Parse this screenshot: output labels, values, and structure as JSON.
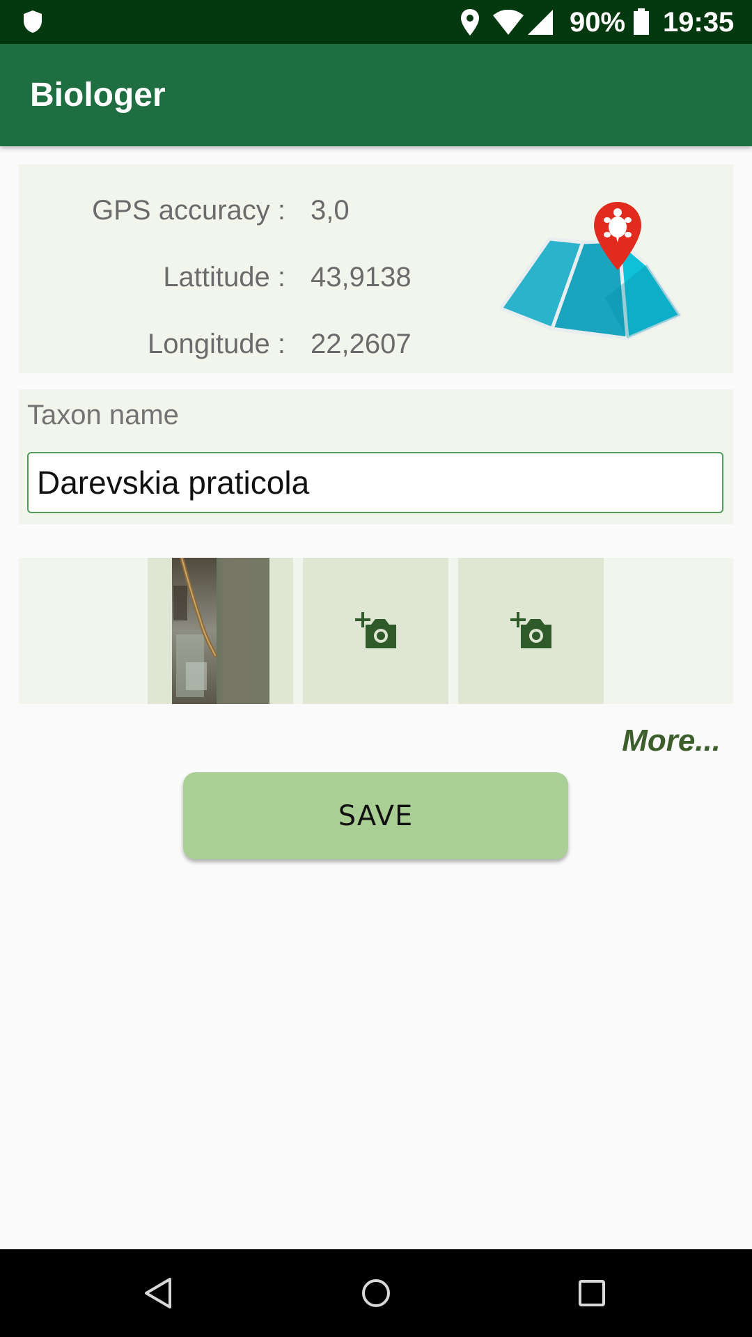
{
  "status_bar": {
    "battery_text": "90%",
    "time": "19:35",
    "icons": [
      "shield-icon",
      "location-icon",
      "wifi-icon",
      "cell-signal-icon",
      "battery-icon"
    ]
  },
  "app_bar": {
    "title": "Biologer"
  },
  "gps": {
    "accuracy_label": "GPS accuracy :",
    "accuracy_value": "3,0",
    "latitude_label": "Lattitude :",
    "latitude_value": "43,9138",
    "longitude_label": "Longitude :",
    "longitude_value": "22,2607",
    "map_icon": "map-pin-turtle-icon"
  },
  "taxon": {
    "label": "Taxon name",
    "value": "Darevskia praticola"
  },
  "photos": {
    "slots": [
      {
        "type": "photo",
        "description": "lizard-on-tree-thumbnail"
      },
      {
        "type": "add",
        "icon": "add-photo-icon"
      },
      {
        "type": "add",
        "icon": "add-photo-icon"
      }
    ]
  },
  "more_link": "More...",
  "save_label": "SAVE",
  "nav_bar": {
    "icons": [
      "back-icon",
      "home-icon",
      "recents-icon"
    ]
  },
  "colors": {
    "status_bar": "#04380f",
    "app_bar": "#1f6e42",
    "panel": "#f2f5ec",
    "photo_slot": "#dfe6d3",
    "save_button": "#aacf94",
    "accent_dark": "#3c5e2b"
  }
}
